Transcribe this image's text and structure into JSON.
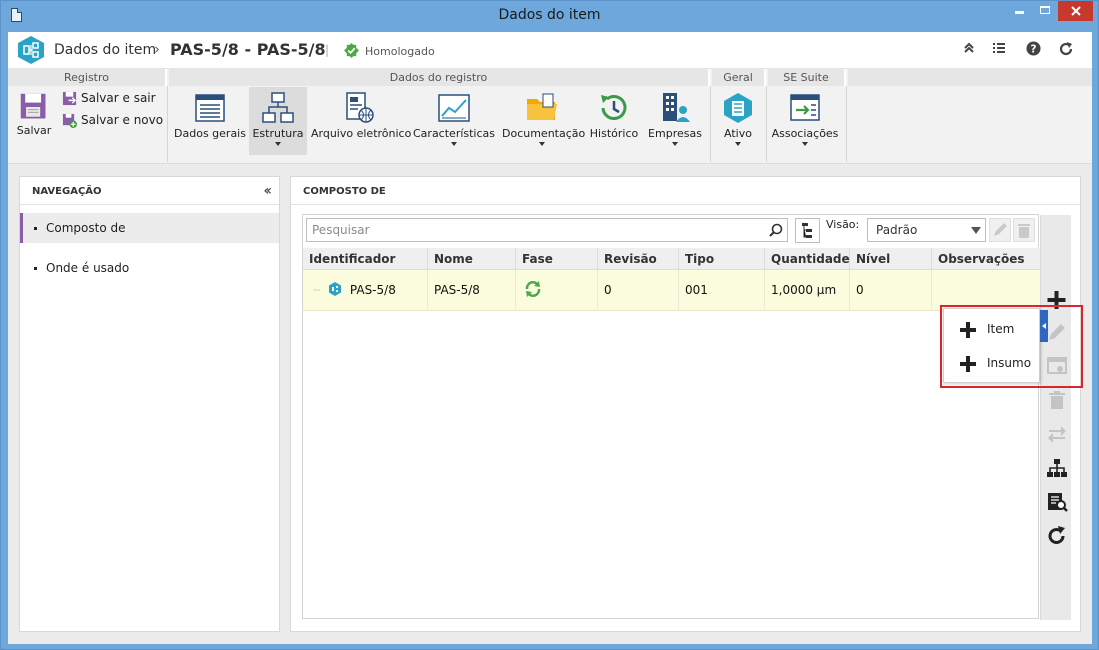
{
  "window": {
    "title": "Dados do item"
  },
  "header": {
    "app": "Dados do item",
    "record": "PAS-5/8 - PAS-5/8",
    "status": "Homologado"
  },
  "ribbon": {
    "groups": {
      "registro": "Registro",
      "dados_registro": "Dados do registro",
      "geral": "Geral",
      "se_suite": "SE Suite"
    },
    "salvar": "Salvar",
    "salvar_sair": "Salvar e sair",
    "salvar_novo": "Salvar e novo",
    "dados_gerais": "Dados gerais",
    "estrutura": "Estrutura",
    "arquivo": "Arquivo eletrônico",
    "caracteristicas": "Características",
    "documentacao": "Documentação",
    "historico": "Histórico",
    "empresas": "Empresas",
    "ativo": "Ativo",
    "associacoes": "Associações"
  },
  "nav": {
    "title": "NAVEGAÇÃO",
    "items": [
      "Composto de",
      "Onde é usado"
    ]
  },
  "main": {
    "title": "COMPOSTO DE",
    "search_placeholder": "Pesquisar",
    "visao_label": "Visão:",
    "visao_value": "Padrão",
    "columns": [
      "Identificador",
      "Nome",
      "Fase",
      "Revisão",
      "Tipo",
      "Quantidade",
      "Nível",
      "Observações"
    ],
    "rows": [
      {
        "identificador": "PAS-5/8",
        "nome": "PAS-5/8",
        "revisao": "0",
        "tipo": "001",
        "quantidade": "1,0000 µm",
        "nivel": "0",
        "observacoes": ""
      }
    ],
    "popup": [
      "Item",
      "Insumo"
    ]
  },
  "colors": {
    "accent": "#8b5ca8",
    "row_highlight": "#fbfbdd",
    "highlight_border": "#d9262c",
    "popup_arrow": "#2f66c0"
  }
}
